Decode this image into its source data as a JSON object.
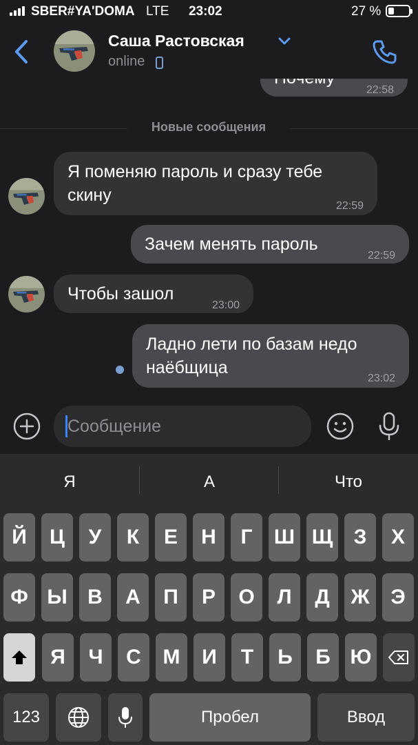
{
  "status_bar": {
    "carrier": "SBER#YA'DOMA",
    "network": "LTE",
    "time": "23:02",
    "battery": "27 %",
    "battery_level": 0.27
  },
  "header": {
    "contact_name": "Саша Растовская",
    "presence": "online",
    "icons": [
      "back-chevron-icon",
      "avatar",
      "chevron-down-icon",
      "mobile-phone-icon",
      "phone-call-icon"
    ],
    "accent_color": "#5b9bf0"
  },
  "chat": {
    "previous_message": {
      "text": "Почему",
      "time": "22:58"
    },
    "divider_label": "Новые сообщения",
    "messages": [
      {
        "direction": "in",
        "lines": [
          "Я поменяю пароль и сразу тебе",
          "скину"
        ],
        "time": "22:59"
      },
      {
        "direction": "out",
        "lines": [
          "Зачем менять пароль"
        ],
        "time": "22:59"
      },
      {
        "direction": "in",
        "lines": [
          "Чтобы зашол"
        ],
        "time": "23:00"
      },
      {
        "direction": "out",
        "lines": [
          "Ладно лети по базам недо",
          "наёбщица"
        ],
        "time": "23:02",
        "unread": true
      }
    ]
  },
  "composer": {
    "placeholder": "Сообщение",
    "icons": [
      "add-circle-icon",
      "emoji-icon",
      "microphone-icon"
    ]
  },
  "keyboard": {
    "suggestions": [
      "Я",
      "А",
      "Что"
    ],
    "row1": [
      "Й",
      "Ц",
      "У",
      "К",
      "Е",
      "Н",
      "Г",
      "Ш",
      "Щ",
      "З",
      "Х"
    ],
    "row2": [
      "Ф",
      "Ы",
      "В",
      "А",
      "П",
      "Р",
      "О",
      "Л",
      "Д",
      "Ж",
      "Э"
    ],
    "row3": [
      "Я",
      "Ч",
      "С",
      "М",
      "И",
      "Т",
      "Ь",
      "Б",
      "Ю"
    ],
    "numbers_label": "123",
    "space_label": "Пробел",
    "return_label": "Ввод",
    "icons": [
      "shift-arrow-icon",
      "backspace-icon",
      "globe-icon",
      "dictation-mic-icon"
    ]
  }
}
